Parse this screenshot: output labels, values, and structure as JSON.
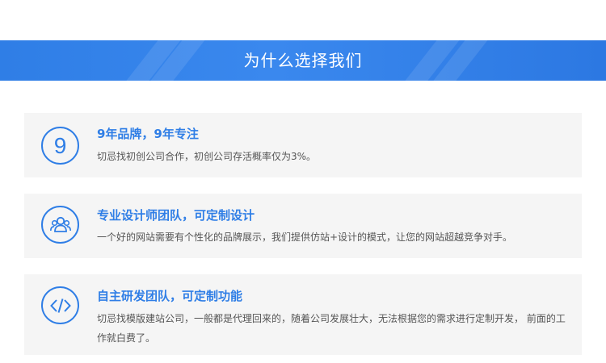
{
  "banner": {
    "title": "为什么选择我们"
  },
  "features": [
    {
      "icon": "nine-number-icon",
      "icon_text": "9",
      "title": "9年品牌，9年专注",
      "description": "切忌找初创公司合作，初创公司存活概率仅为3%。"
    },
    {
      "icon": "team-icon",
      "title": "专业设计师团队，可定制设计",
      "description": "一个好的网站需要有个性化的品牌展示，我们提供仿站+设计的模式，让您的网站超越竞争对手。"
    },
    {
      "icon": "code-icon",
      "title": "自主研发团队，可定制功能",
      "description": "切忌找模版建站公司，一般都是代理回来的，随着公司发展壮大，无法根据您的需求进行定制开发， 前面的工作就白费了。"
    }
  ],
  "colors": {
    "accent": "#2f7ee6",
    "card_bg": "#f5f5f5",
    "text": "#555555"
  }
}
